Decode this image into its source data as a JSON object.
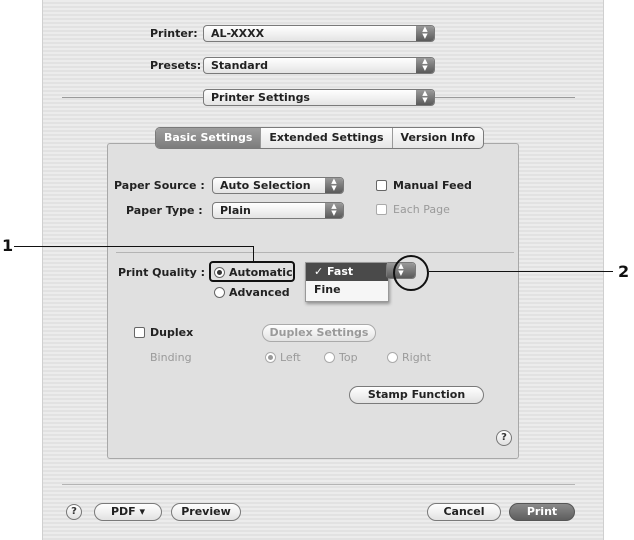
{
  "top": {
    "printer_label": "Printer:",
    "printer_value": "AL-XXXX",
    "presets_label": "Presets:",
    "presets_value": "Standard",
    "panel_value": "Printer Settings"
  },
  "tabs": [
    "Basic Settings",
    "Extended Settings",
    "Version Info"
  ],
  "basic": {
    "paper_source_label": "Paper Source :",
    "paper_source_value": "Auto Selection",
    "manual_feed_label": "Manual Feed",
    "paper_type_label": "Paper Type :",
    "paper_type_value": "Plain",
    "each_page_label": "Each Page",
    "print_quality_label": "Print Quality :",
    "automatic_label": "Automatic",
    "advanced_label": "Advanced",
    "quality_menu": {
      "selected": "✓ Fast",
      "other": "Fine"
    },
    "duplex_label": "Duplex",
    "duplex_settings_label": "Duplex Settings",
    "binding_label": "Binding",
    "binding_left": "Left",
    "binding_top": "Top",
    "binding_right": "Right",
    "stamp_label": "Stamp Function",
    "help_label": "?"
  },
  "bottom": {
    "help_label": "?",
    "pdf_label": "PDF ▾",
    "preview_label": "Preview",
    "cancel_label": "Cancel",
    "print_label": "Print"
  },
  "callouts": {
    "one": "1",
    "two": "2"
  }
}
